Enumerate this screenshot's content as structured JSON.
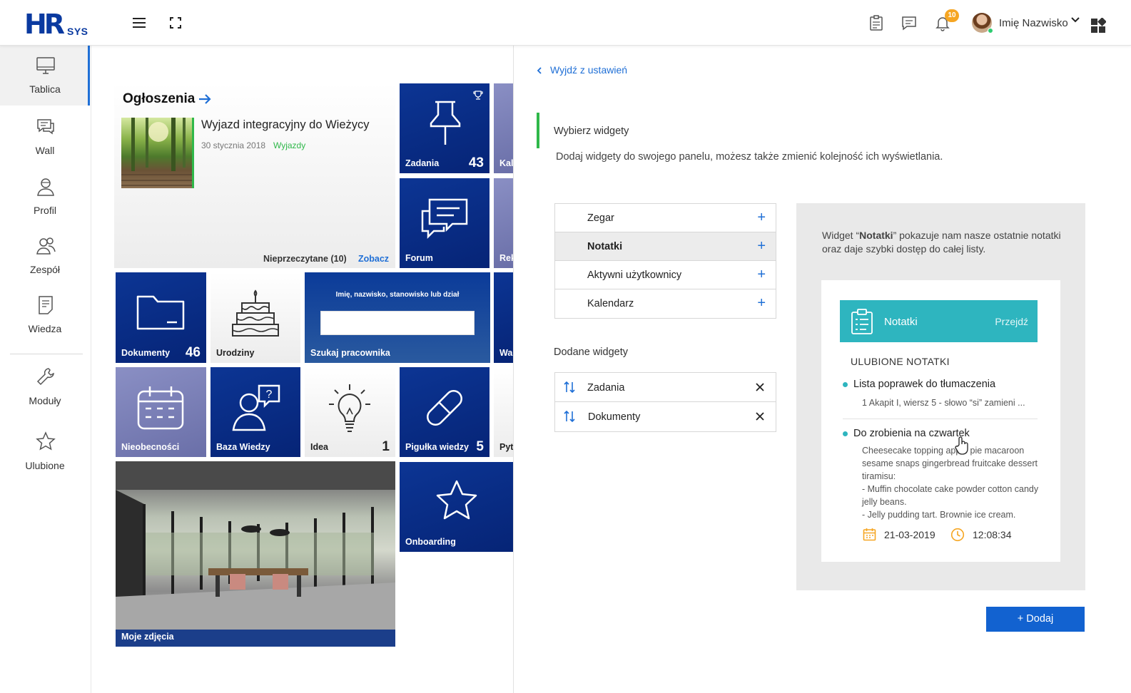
{
  "topbar": {
    "logo_hr": "HR",
    "logo_sys": "SYS",
    "notification_count": "10",
    "user_name": "Imię Nazwisko"
  },
  "sidebar": {
    "items": [
      {
        "label": "Tablica",
        "icon": "monitor-icon",
        "active": true
      },
      {
        "label": "Wall",
        "icon": "chat-icon"
      },
      {
        "label": "Profil",
        "icon": "user-icon"
      },
      {
        "label": "Zespół",
        "icon": "team-icon"
      },
      {
        "label": "Wiedza",
        "icon": "document-icon"
      },
      {
        "label": "Moduły",
        "icon": "wrench-icon"
      },
      {
        "label": "Ulubione",
        "icon": "star-icon"
      }
    ]
  },
  "dashboard": {
    "announcements": {
      "title": "Ogłoszenia",
      "headline": "Wyjazd integracyjny do Wieżycy",
      "date": "30 stycznia 2018",
      "category": "Wyjazdy",
      "unread": "Nieprzeczytane (10)",
      "see": "Zobacz"
    },
    "tiles": {
      "zadania": {
        "label": "Zadania",
        "count": "43"
      },
      "kalendarz": {
        "label": "Kal"
      },
      "forum": {
        "label": "Forum"
      },
      "rekrutacja": {
        "label": "Rek"
      },
      "dokumenty": {
        "label": "Dokumenty",
        "count": "46"
      },
      "urodziny": {
        "label": "Urodziny"
      },
      "szukaj": {
        "label": "Szukaj pracownika",
        "hint": "Imię, nazwisko, stanowisko lub dział"
      },
      "wall": {
        "label": "Wal"
      },
      "nieobecnosci": {
        "label": "Nieobecności"
      },
      "baza": {
        "label": "Baza Wiedzy"
      },
      "idea": {
        "label": "Idea",
        "count": "1"
      },
      "pigulka": {
        "label": "Pigułka wiedzy",
        "count": "5"
      },
      "pytania": {
        "label": "Pyta"
      },
      "zdjecia": {
        "label": "Moje zdjęcia"
      },
      "onboarding": {
        "label": "Onboarding"
      }
    }
  },
  "settings": {
    "back": "Wyjdź z ustawień",
    "section_title": "Wybierz widgety",
    "section_desc": "Dodaj widgety do swojego panelu, możesz także zmienić kolejność ich wyświetlania.",
    "available": [
      {
        "name": "Zegar"
      },
      {
        "name": "Notatki",
        "selected": true
      },
      {
        "name": "Aktywni użytkownicy"
      },
      {
        "name": "Kalendarz"
      }
    ],
    "added_title": "Dodane widgety",
    "added": [
      {
        "name": "Zadania"
      },
      {
        "name": "Dokumenty"
      }
    ],
    "preview": {
      "desc_prefix": "Widget “",
      "desc_bold": "Notatki",
      "desc_suffix": "” pokazuje nam nasze ostatnie notatki oraz daje szybki dostęp do całej listy.",
      "card_title": "Notatki",
      "card_link": "Przejdź",
      "favorites": "ULUBIONE NOTATKI",
      "notes": [
        {
          "title": "Lista poprawek do tłumaczenia",
          "body": "1 Akapit I, wiersz 5 - słowo “si” zamieni ..."
        },
        {
          "title": "Do zrobienia na czwartek",
          "body": "Cheesecake topping apple pie macaroon sesame snaps gingerbread fruitcake dessert tiramisu:\n- Muffin chocolate cake powder cotton candy jelly beans.\n- Jelly pudding tart. Brownie ice cream."
        }
      ],
      "date": "21-03-2019",
      "time": "12:08:34"
    },
    "add_button": "Dodaj"
  },
  "colors": {
    "accent": "#1f6fd6",
    "navy_tile": "#0b2d8c",
    "teal": "#2eb5bf",
    "green": "#2fb84a",
    "badge": "#f6a623"
  }
}
